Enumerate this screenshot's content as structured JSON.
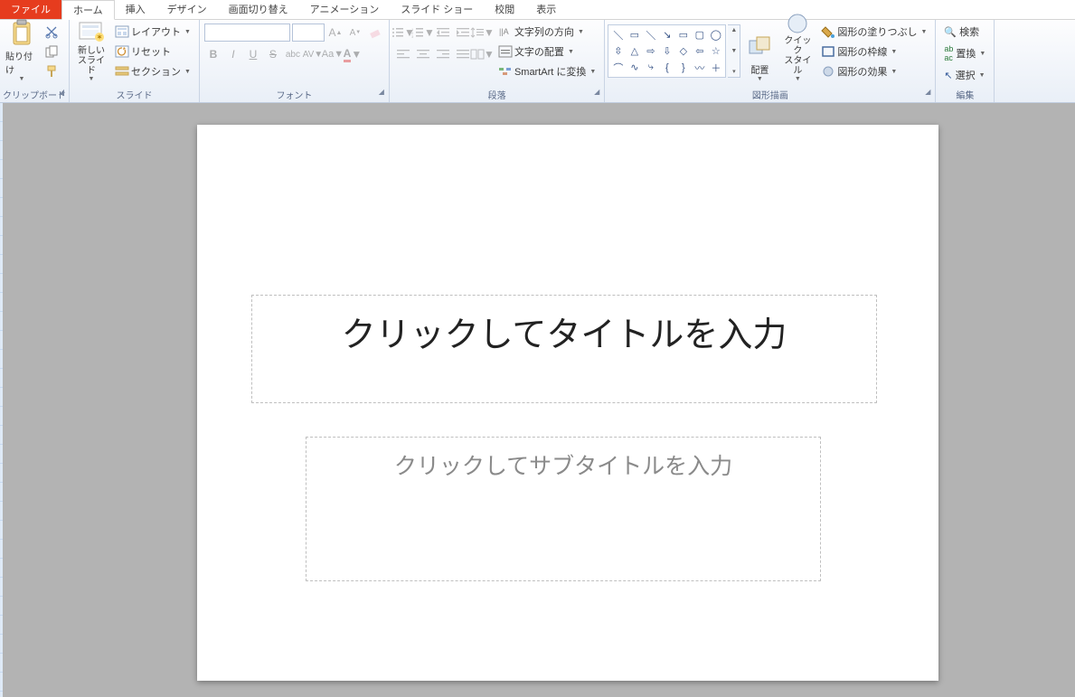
{
  "tabs": {
    "file": "ファイル",
    "home": "ホーム",
    "insert": "挿入",
    "design": "デザイン",
    "transitions": "画面切り替え",
    "animations": "アニメーション",
    "slideshow": "スライド ショー",
    "review": "校閲",
    "view": "表示"
  },
  "ribbon": {
    "clipboard": {
      "label": "クリップボード",
      "paste": "貼り付け"
    },
    "slides": {
      "label": "スライド",
      "new_slide": "新しい\nスライド",
      "layout": "レイアウト",
      "reset": "リセット",
      "section": "セクション"
    },
    "font": {
      "label": "フォント"
    },
    "paragraph": {
      "label": "段落",
      "text_direction": "文字列の方向",
      "text_align": "文字の配置",
      "smartart": "SmartArt に変換"
    },
    "drawing": {
      "label": "図形描画",
      "arrange": "配置",
      "quick_styles": "クイック\nスタイル",
      "shape_fill": "図形の塗りつぶし",
      "shape_outline": "図形の枠線",
      "shape_effects": "図形の効果"
    },
    "editing": {
      "label": "編集",
      "find": "検索",
      "replace": "置換",
      "select": "選択"
    }
  },
  "slide": {
    "title_placeholder": "クリックしてタイトルを入力",
    "subtitle_placeholder": "クリックしてサブタイトルを入力"
  }
}
